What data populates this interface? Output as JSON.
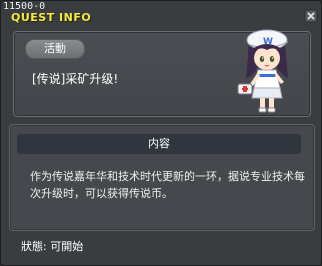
{
  "window": {
    "id_label": "11500-0",
    "title": "QUEST INFO"
  },
  "quest": {
    "badge": "活動",
    "title": "[传说]采矿升级!",
    "npc_icon": "npc-girl-portrait"
  },
  "content": {
    "header": "内容",
    "body": "作为传说嘉年华和技术时代更新的一环，据说专业技术每次升级时，可以获得传说币。"
  },
  "status": {
    "text": "狀態:  可開始"
  },
  "colors": {
    "title": "#f1e94a",
    "window_bg": "#3a3d40",
    "card_bg": "#4a4e52",
    "header_bg": "#2f363d"
  }
}
